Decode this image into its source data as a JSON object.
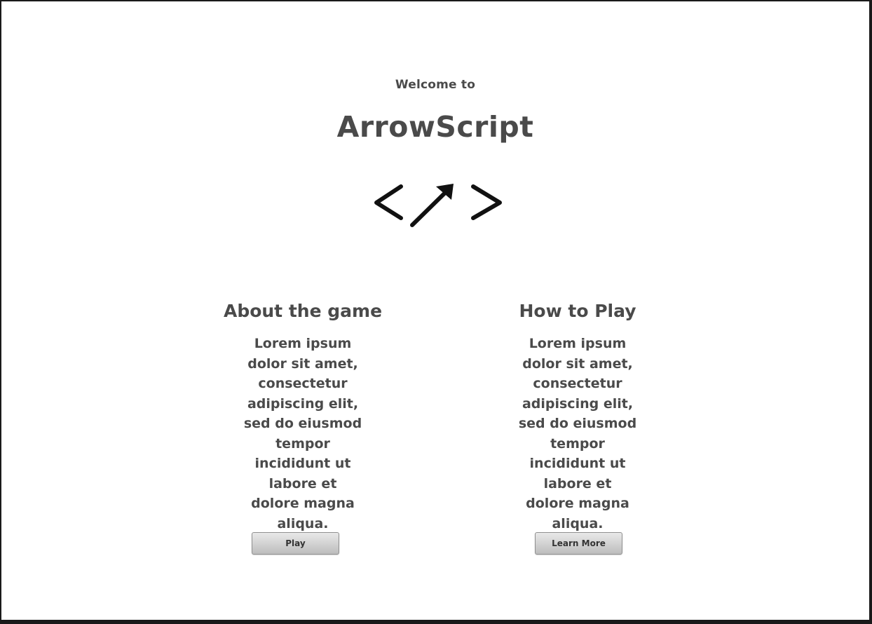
{
  "header": {
    "welcome_text": "Welcome to",
    "app_title": "ArrowScript",
    "logo_icon": "code-arrow-logo-icon"
  },
  "about": {
    "heading": "About the game",
    "body": "Lorem ipsum dolor sit amet, consectetur adipiscing elit, sed do eiusmod tempor incididunt ut labore et dolore magna aliqua.",
    "button_label": "Play"
  },
  "how_to_play": {
    "heading": "How to Play",
    "body": "Lorem ipsum dolor sit amet, consectetur adipiscing elit, sed do eiusmod tempor incididunt ut labore et dolore magna aliqua.",
    "button_label": "Learn More"
  },
  "colors": {
    "text": "#4a4a4a",
    "background": "#ffffff",
    "frame": "#1a1a1a",
    "button_top": "#e9e9e9",
    "button_bottom": "#bdbdbd"
  }
}
